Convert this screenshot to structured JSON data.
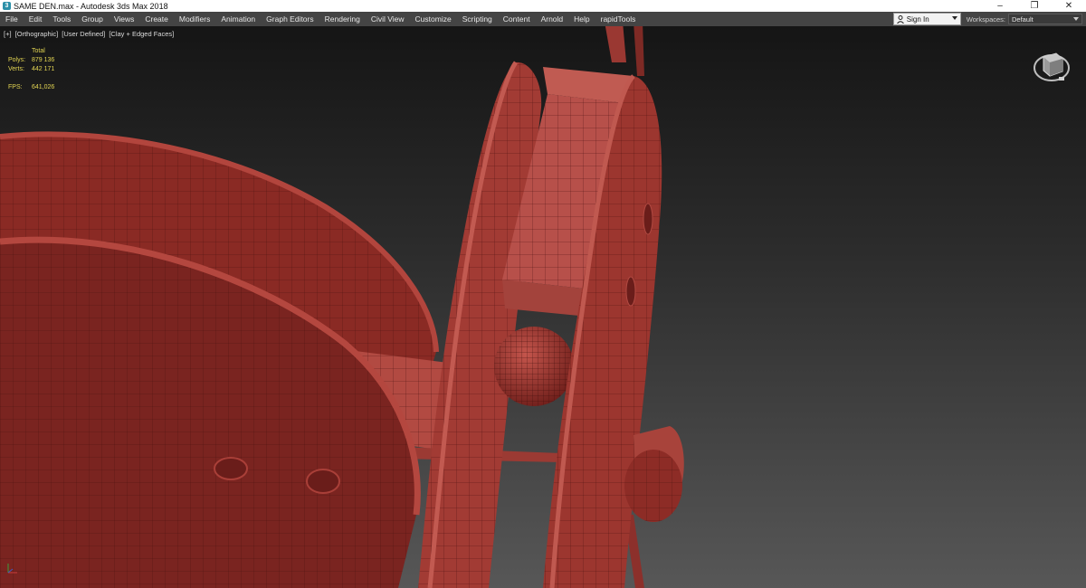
{
  "window": {
    "title": "SAME DEN.max - Autodesk 3ds Max 2018",
    "icon": "3ds-max-app-icon",
    "controls": {
      "minimize": "–",
      "restore": "❐",
      "close": "✕"
    }
  },
  "menubar": {
    "items": [
      "File",
      "Edit",
      "Tools",
      "Group",
      "Views",
      "Create",
      "Modifiers",
      "Animation",
      "Graph Editors",
      "Rendering",
      "Civil View",
      "Customize",
      "Scripting",
      "Content",
      "Arnold",
      "Help",
      "rapidTools"
    ],
    "signin_label": "Sign In",
    "workspaces_label": "Workspaces:",
    "workspace_value": "Default"
  },
  "viewport": {
    "label_parts": [
      "[+]",
      "[Orthographic]",
      "[User Defined]",
      "[Clay + Edged Faces]"
    ],
    "stats": {
      "total_label": "Total",
      "polys_label": "Polys:",
      "polys_value": "879 136",
      "verts_label": "Verts:",
      "verts_value": "442 171",
      "fps_label": "FPS:",
      "fps_value": "641,026"
    },
    "colors": {
      "clay": "#b5473f",
      "clay_dark": "#7d2520",
      "wire": "#3d0e0c",
      "stats_text": "#e3d552"
    }
  }
}
